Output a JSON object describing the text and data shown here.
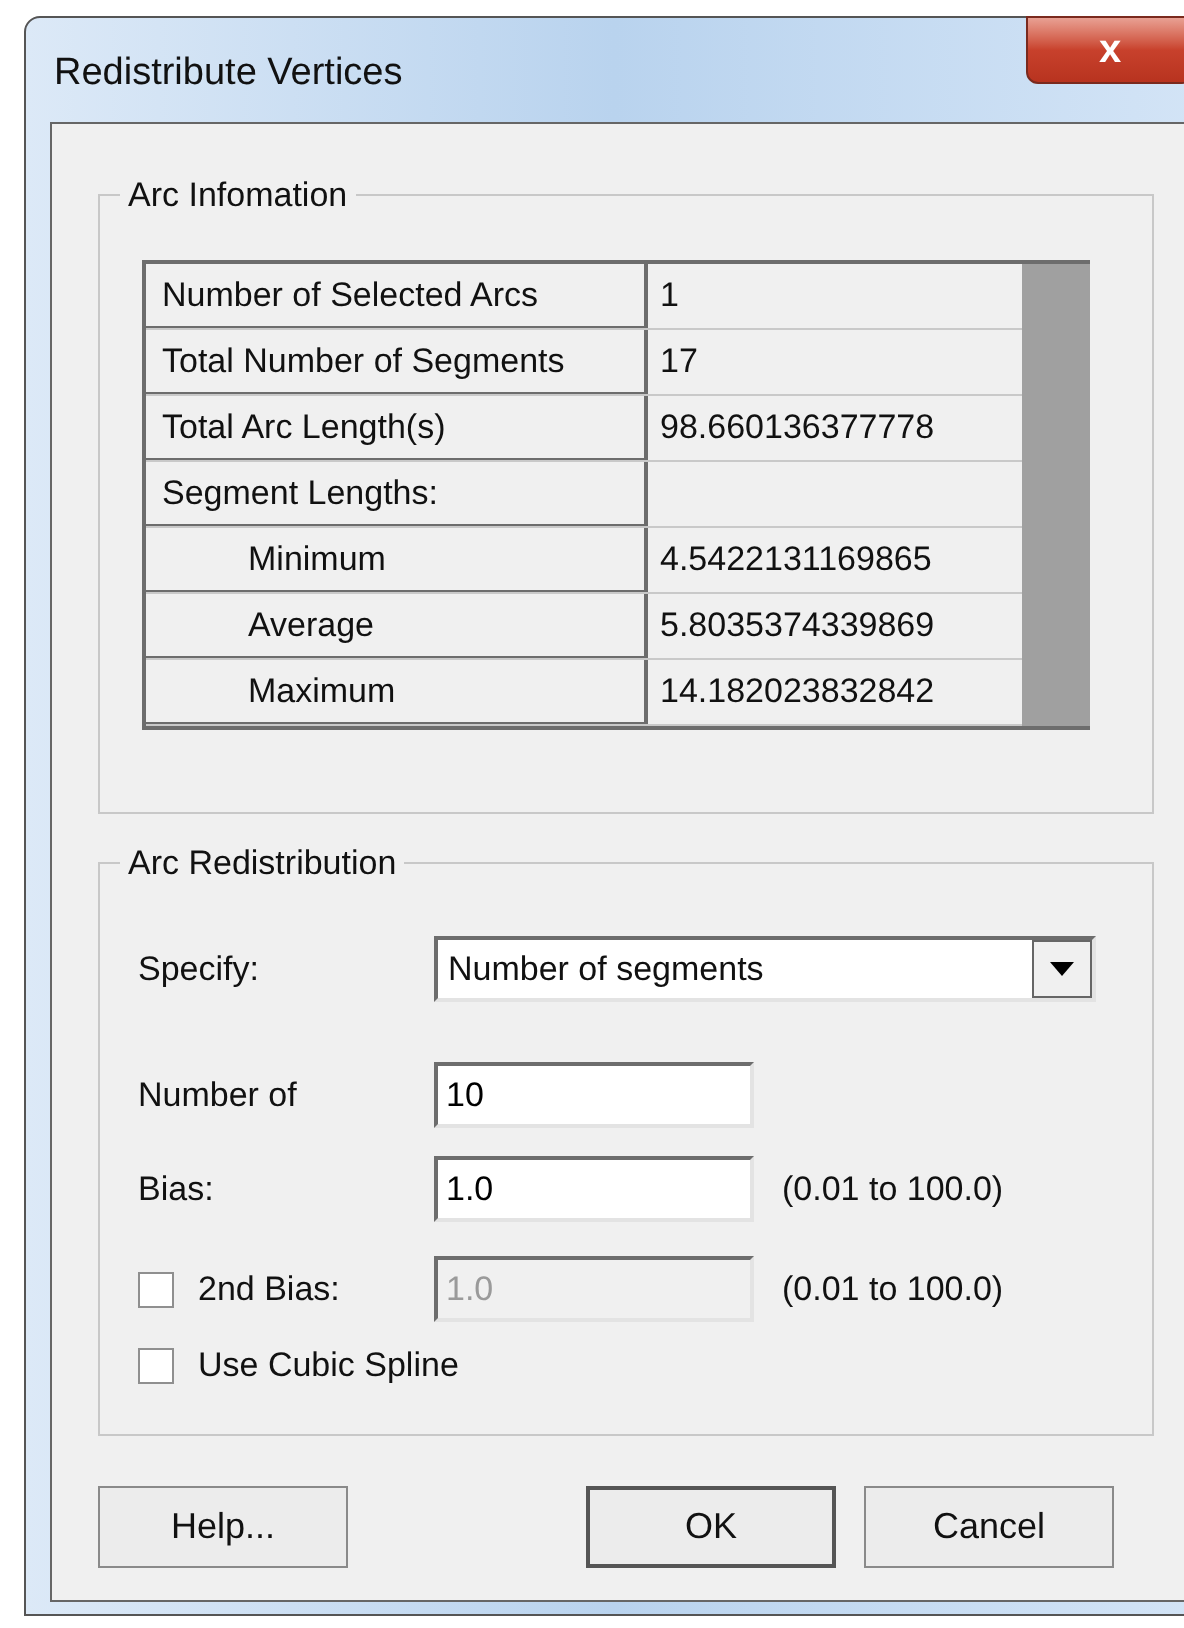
{
  "window": {
    "title": "Redistribute Vertices",
    "close": "x"
  },
  "arc_information": {
    "title": "Arc Infomation",
    "rows": [
      {
        "label": "Number of Selected Arcs",
        "value": "1"
      },
      {
        "label": "Total Number of Segments",
        "value": "17"
      },
      {
        "label": "Total Arc Length(s)",
        "value": "98.660136377778"
      },
      {
        "label": "Segment Lengths:",
        "children": [
          {
            "label": "Minimum",
            "value": "4.5422131169865"
          },
          {
            "label": "Average",
            "value": "5.8035374339869"
          },
          {
            "label": "Maximum",
            "value": "14.182023832842"
          }
        ]
      }
    ]
  },
  "arc_redistribution": {
    "title": "Arc Redistribution",
    "specify": {
      "label": "Specify:",
      "value": "Number of segments"
    },
    "number_of": {
      "label": "Number of",
      "value": "10"
    },
    "bias": {
      "label": "Bias:",
      "value": "1.0",
      "range": "(0.01 to 100.0)"
    },
    "second_bias": {
      "label": "2nd Bias:",
      "checked": false,
      "value": "1.0",
      "disabled": true,
      "range": "(0.01 to 100.0)"
    },
    "cubic_spline": {
      "label": "Use Cubic Spline",
      "checked": false
    }
  },
  "buttons": [
    {
      "label": "Help...",
      "default": false
    },
    {
      "label": "OK",
      "default": true
    },
    {
      "label": "Cancel",
      "default": false
    }
  ]
}
